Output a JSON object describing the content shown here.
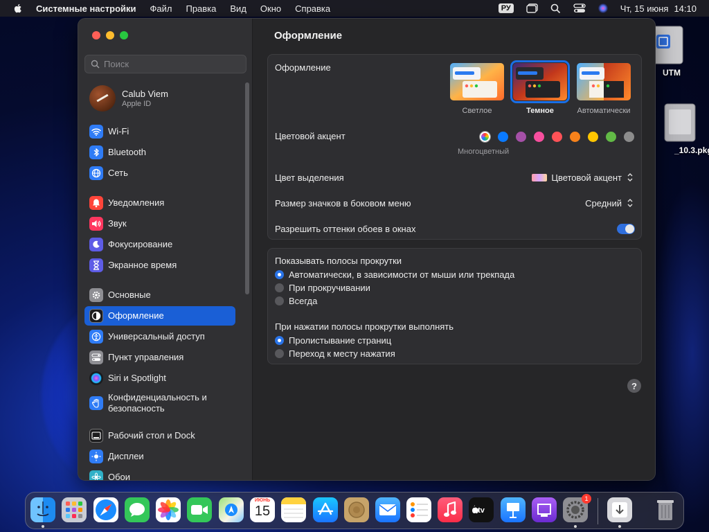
{
  "menubar": {
    "app_name": "Системные настройки",
    "items": [
      "Файл",
      "Правка",
      "Вид",
      "Окно",
      "Справка"
    ],
    "input_lang": "РУ",
    "date": "Чт, 15 июня",
    "time": "14:10"
  },
  "desktop": {
    "icons": [
      {
        "label": "UTM"
      },
      {
        "label": "_10.3.pkg"
      }
    ]
  },
  "sidebar": {
    "search_placeholder": "Поиск",
    "account": {
      "name": "Calub Viem",
      "subtitle": "Apple ID"
    },
    "items": [
      {
        "label": "Wi-Fi",
        "icon": "wifi-icon",
        "color": "#2f7cf6"
      },
      {
        "label": "Bluetooth",
        "icon": "bluetooth-icon",
        "color": "#2f7cf6"
      },
      {
        "label": "Сеть",
        "icon": "globe-icon",
        "color": "#2f7cf6"
      },
      {
        "label": "Уведомления",
        "icon": "bell-icon",
        "color": "#ff453a"
      },
      {
        "label": "Звук",
        "icon": "speaker-icon",
        "color": "#ff375f"
      },
      {
        "label": "Фокусирование",
        "icon": "moon-icon",
        "color": "#5e5ce6"
      },
      {
        "label": "Экранное время",
        "icon": "hourglass-icon",
        "color": "#5e5ce6"
      },
      {
        "label": "Основные",
        "icon": "gear-icon",
        "color": "#8e8e93"
      },
      {
        "label": "Оформление",
        "icon": "appearance-icon",
        "color": "#1c1c1e"
      },
      {
        "label": "Универсальный доступ",
        "icon": "accessibility-icon",
        "color": "#2f7cf6"
      },
      {
        "label": "Пункт управления",
        "icon": "control-center-icon",
        "color": "#8e8e93"
      },
      {
        "label": "Siri и Spotlight",
        "icon": "siri-icon",
        "color": "#6b3fd1"
      },
      {
        "label": "Конфиденциальность и безопасность",
        "icon": "hand-icon",
        "color": "#2f7cf6"
      },
      {
        "label": "Рабочий стол и Dock",
        "icon": "dock-icon",
        "color": "#1c1c1e"
      },
      {
        "label": "Дисплеи",
        "icon": "display-icon",
        "color": "#2f7cf6"
      },
      {
        "label": "Обои",
        "icon": "wallpaper-icon",
        "color": "#30b0c7"
      }
    ],
    "active_index": 8
  },
  "content": {
    "title": "Оформление",
    "appearance": {
      "label": "Оформление",
      "options": [
        {
          "name": "Светлое",
          "selected": false
        },
        {
          "name": "Темное",
          "selected": true
        },
        {
          "name": "Автоматически",
          "selected": false
        }
      ]
    },
    "accent": {
      "label": "Цветовой акцент",
      "colors": [
        "multicolor",
        "#0a7aff",
        "#a550a7",
        "#f74f9e",
        "#ff5257",
        "#f7821b",
        "#ffc600",
        "#62ba46",
        "#8c8c8c"
      ],
      "caption": "Многоцветный"
    },
    "highlight": {
      "label": "Цвет выделения",
      "value": "Цветовой акцент"
    },
    "sidebar_icon_size": {
      "label": "Размер значков в боковом меню",
      "value": "Средний"
    },
    "wallpaper_tinting": {
      "label": "Разрешить оттенки обоев в окнах",
      "enabled": true
    },
    "scrollbars": {
      "heading": "Показывать полосы прокрутки",
      "options": [
        {
          "label": "Автоматически, в зависимости от мыши или трекпада",
          "checked": true
        },
        {
          "label": "При прокручивании",
          "checked": false
        },
        {
          "label": "Всегда",
          "checked": false
        }
      ]
    },
    "scroll_click": {
      "heading": "При нажатии полосы прокрутки выполнять",
      "options": [
        {
          "label": "Пролистывание страниц",
          "checked": true
        },
        {
          "label": "Переход к месту нажатия",
          "checked": false
        }
      ]
    },
    "help": "?"
  },
  "dock": {
    "apps": [
      "finder",
      "launchpad",
      "safari",
      "messages",
      "photos",
      "facetime",
      "maps",
      "calendar",
      "notes",
      "app-store",
      "xcode-like",
      "mail",
      "reminders",
      "music",
      "tv",
      "keynote",
      "podcasts",
      "system-settings",
      "downloads",
      "trash"
    ],
    "calendar": {
      "month": "ИЮНЬ",
      "day": "15"
    },
    "settings_badge": "1"
  }
}
